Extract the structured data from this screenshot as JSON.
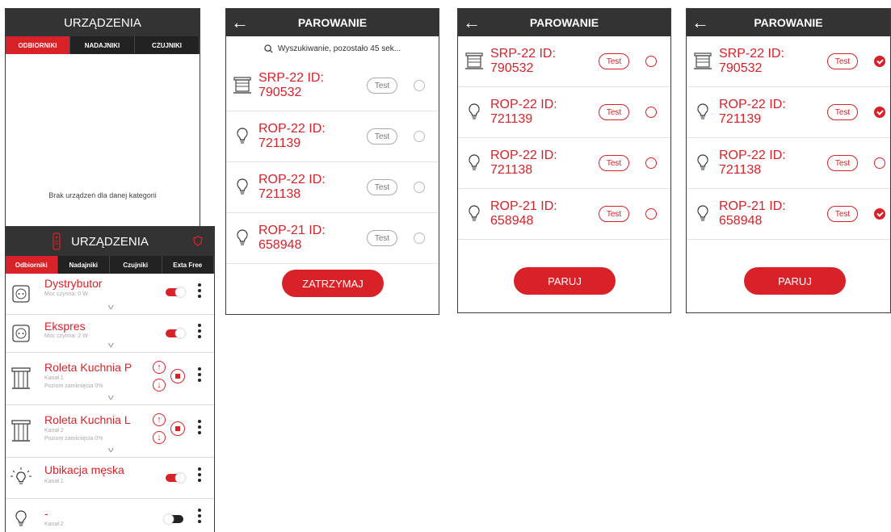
{
  "screen1": {
    "title": "URZĄDZENIA",
    "tabs": [
      "ODBIORNIKI",
      "NADAJNIKI",
      "CZUJNIKI"
    ],
    "empty_message": "Brak urządzeń dla danej kategorii"
  },
  "screen2": {
    "title": "PAROWANIE",
    "search_text": "Wyszukiwanie, pozostało 45 sek...",
    "items": [
      {
        "name": "SRP-22 ID: 790532",
        "icon": "blind-icon",
        "test": "Test"
      },
      {
        "name": "ROP-22 ID: 721139",
        "icon": "bulb-icon",
        "test": "Test"
      },
      {
        "name": "ROP-22 ID: 721138",
        "icon": "bulb-icon",
        "test": "Test"
      },
      {
        "name": "ROP-21 ID: 658948",
        "icon": "bulb-icon",
        "test": "Test"
      }
    ],
    "button": "ZATRZYMAJ"
  },
  "screen3": {
    "title": "PAROWANIE",
    "items": [
      {
        "name": "SRP-22 ID: 790532",
        "test": "Test",
        "checked": false
      },
      {
        "name": "ROP-22 ID: 721139",
        "test": "Test",
        "checked": false
      },
      {
        "name": "ROP-22 ID: 721138",
        "test": "Test",
        "checked": false
      },
      {
        "name": "ROP-21 ID: 658948",
        "test": "Test",
        "checked": false
      }
    ],
    "button": "PARUJ"
  },
  "screen4": {
    "title": "PAROWANIE",
    "items": [
      {
        "name": "SRP-22 ID: 790532",
        "test": "Test",
        "checked": true
      },
      {
        "name": "ROP-22 ID: 721139",
        "test": "Test",
        "checked": true
      },
      {
        "name": "ROP-22 ID: 721138",
        "test": "Test",
        "checked": false
      },
      {
        "name": "ROP-21 ID: 658948",
        "test": "Test",
        "checked": true
      }
    ],
    "button": "PARUJ"
  },
  "screen5": {
    "title": "URZĄDZENIA",
    "tabs": [
      "Odbiorniki",
      "Nadajniki",
      "Czujniki",
      "Exta Free"
    ],
    "devices": [
      {
        "name": "Dystrybutor",
        "sub1": "Moc czynna: 0 W",
        "sub2": "",
        "control": "toggle-on"
      },
      {
        "name": "Ekspres",
        "sub1": "Moc czynna: 2 W",
        "sub2": "",
        "control": "toggle-on"
      },
      {
        "name": "Roleta Kuchnia P",
        "sub1": "Kanał 1",
        "sub2": "Poziom zamknięcia 0%",
        "control": "blind"
      },
      {
        "name": "Roleta Kuchnia L",
        "sub1": "Kanał 2",
        "sub2": "Poziom zamknięcia 0%",
        "control": "blind"
      },
      {
        "name": "Ubikacja męska",
        "sub1": "Kanał 1",
        "sub2": "",
        "control": "toggle-on"
      },
      {
        "name": "-",
        "sub1": "Kanał 2",
        "sub2": "",
        "control": "toggle-off"
      }
    ],
    "colors": {
      "accent": "#d92128",
      "header": "#333333"
    }
  }
}
